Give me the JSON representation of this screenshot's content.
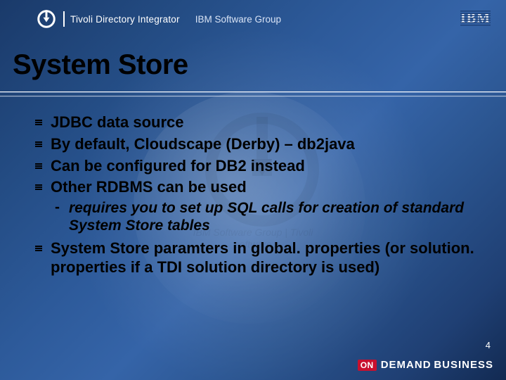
{
  "header": {
    "product": "Tivoli Directory Integrator",
    "group": "IBM Software Group",
    "company_logo": "IBM"
  },
  "title": "System Store",
  "bullets": [
    "JDBC data source",
    "By default, Cloudscape (Derby) – db2java",
    "Can be configured for DB2 instead",
    "Other RDBMS can be used",
    "System Store paramters in global. properties (or solution. properties if a TDI solution directory is used)"
  ],
  "sub_bullets_of_4": [
    "requires you to set up SQL calls for creation of standard System Store tables"
  ],
  "watermark": {
    "line1": "IBM Software Group | Tivoli software",
    "line2": ""
  },
  "footer": {
    "page_number": "4",
    "badge": "ON",
    "tagline_demand": "DEMAND",
    "tagline_business": "BUSINESS"
  }
}
